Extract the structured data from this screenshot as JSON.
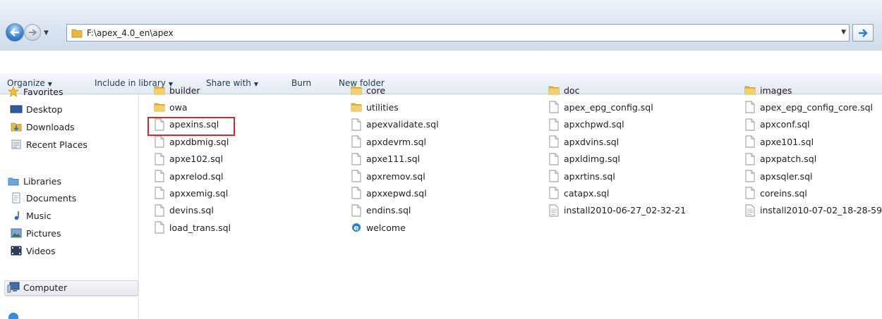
{
  "address_bar": {
    "path": "F:\\apex_4.0_en\\apex",
    "back_icon": "back-arrow-icon",
    "forward_icon": "forward-arrow-icon",
    "go_icon": "go-arrow-icon"
  },
  "toolbar": {
    "organize": "Organize",
    "include_in_library": "Include in library",
    "share_with": "Share with",
    "burn": "Burn",
    "new_folder": "New folder"
  },
  "nav": {
    "favorites": "Favorites",
    "desktop": "Desktop",
    "downloads": "Downloads",
    "recent_places": "Recent Places",
    "libraries": "Libraries",
    "documents": "Documents",
    "music": "Music",
    "pictures": "Pictures",
    "videos": "Videos",
    "computer": "Computer"
  },
  "files": {
    "col1": [
      "builder",
      "owa",
      "apexins.sql",
      "apxdbmig.sql",
      "apxe102.sql",
      "apxrelod.sql",
      "apxxemig.sql",
      "devins.sql",
      "load_trans.sql"
    ],
    "col2": [
      "core",
      "utilities",
      "apexvalidate.sql",
      "apxdevrm.sql",
      "apxe111.sql",
      "apxremov.sql",
      "apxxepwd.sql",
      "endins.sql",
      "welcome"
    ],
    "col3": [
      "doc",
      "apex_epg_config.sql",
      "apxchpwd.sql",
      "apxdvins.sql",
      "apxldimg.sql",
      "apxrtins.sql",
      "catapx.sql",
      "install2010-06-27_02-32-21"
    ],
    "col4": [
      "images",
      "apex_epg_config_core.sql",
      "apxconf.sql",
      "apxe101.sql",
      "apxpatch.sql",
      "apxsqler.sql",
      "coreins.sql",
      "install2010-07-02_18-28-59"
    ]
  },
  "highlighted_file": "apexins.sql",
  "colors": {
    "highlight": "#d8262c",
    "folder": "#e8b842"
  }
}
